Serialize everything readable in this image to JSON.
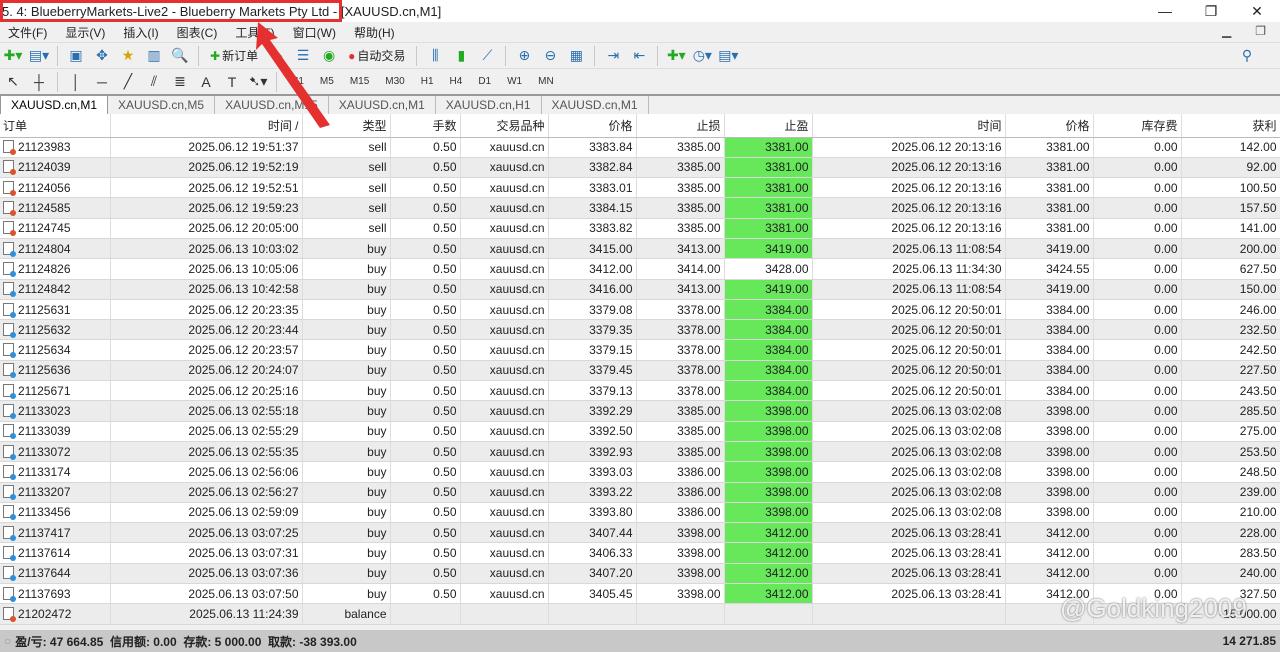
{
  "window": {
    "title": "5.   4: BlueberryMarkets-Live2 - Blueberry Markets Pty Ltd - [XAUUSD.cn,M1]",
    "minimize": "—",
    "restore": "❐",
    "close": "✕"
  },
  "menu": [
    "文件(F)",
    "显示(V)",
    "插入(I)",
    "图表(C)",
    "工具(T)",
    "窗口(W)",
    "帮助(H)"
  ],
  "toolbar": {
    "new_order": "新订单",
    "auto_trade": "自动交易"
  },
  "timeframes": [
    "M1",
    "M5",
    "M15",
    "M30",
    "H1",
    "H4",
    "D1",
    "W1",
    "MN"
  ],
  "chart_tabs": [
    "XAUUSD.cn,M1",
    "XAUUSD.cn,M5",
    "XAUUSD.cn,M15",
    "XAUUSD.cn,M1",
    "XAUUSD.cn,H1",
    "XAUUSD.cn,M1"
  ],
  "columns": [
    "订单",
    "时间 /",
    "类型",
    "手数",
    "交易品种",
    "价格",
    "止损",
    "止盈",
    "时间",
    "价格",
    "库存费",
    "获利"
  ],
  "colors": {
    "tp_hit": "#66e85a",
    "sell_icon": "#d9532c",
    "buy_icon": "#2f8fd8"
  },
  "rows": [
    [
      "21123983",
      "2025.06.12 19:51:37",
      "sell",
      "0.50",
      "xauusd.cn",
      "3383.84",
      "3385.00",
      "3381.00",
      "2025.06.12 20:13:16",
      "3381.00",
      "0.00",
      "142.00",
      true
    ],
    [
      "21124039",
      "2025.06.12 19:52:19",
      "sell",
      "0.50",
      "xauusd.cn",
      "3382.84",
      "3385.00",
      "3381.00",
      "2025.06.12 20:13:16",
      "3381.00",
      "0.00",
      "92.00",
      true
    ],
    [
      "21124056",
      "2025.06.12 19:52:51",
      "sell",
      "0.50",
      "xauusd.cn",
      "3383.01",
      "3385.00",
      "3381.00",
      "2025.06.12 20:13:16",
      "3381.00",
      "0.00",
      "100.50",
      true
    ],
    [
      "21124585",
      "2025.06.12 19:59:23",
      "sell",
      "0.50",
      "xauusd.cn",
      "3384.15",
      "3385.00",
      "3381.00",
      "2025.06.12 20:13:16",
      "3381.00",
      "0.00",
      "157.50",
      true
    ],
    [
      "21124745",
      "2025.06.12 20:05:00",
      "sell",
      "0.50",
      "xauusd.cn",
      "3383.82",
      "3385.00",
      "3381.00",
      "2025.06.12 20:13:16",
      "3381.00",
      "0.00",
      "141.00",
      true
    ],
    [
      "21124804",
      "2025.06.13 10:03:02",
      "buy",
      "0.50",
      "xauusd.cn",
      "3415.00",
      "3413.00",
      "3419.00",
      "2025.06.13 11:08:54",
      "3419.00",
      "0.00",
      "200.00",
      true
    ],
    [
      "21124826",
      "2025.06.13 10:05:06",
      "buy",
      "0.50",
      "xauusd.cn",
      "3412.00",
      "3414.00",
      "3428.00",
      "2025.06.13 11:34:30",
      "3424.55",
      "0.00",
      "627.50",
      false
    ],
    [
      "21124842",
      "2025.06.13 10:42:58",
      "buy",
      "0.50",
      "xauusd.cn",
      "3416.00",
      "3413.00",
      "3419.00",
      "2025.06.13 11:08:54",
      "3419.00",
      "0.00",
      "150.00",
      true
    ],
    [
      "21125631",
      "2025.06.12 20:23:35",
      "buy",
      "0.50",
      "xauusd.cn",
      "3379.08",
      "3378.00",
      "3384.00",
      "2025.06.12 20:50:01",
      "3384.00",
      "0.00",
      "246.00",
      true
    ],
    [
      "21125632",
      "2025.06.12 20:23:44",
      "buy",
      "0.50",
      "xauusd.cn",
      "3379.35",
      "3378.00",
      "3384.00",
      "2025.06.12 20:50:01",
      "3384.00",
      "0.00",
      "232.50",
      true
    ],
    [
      "21125634",
      "2025.06.12 20:23:57",
      "buy",
      "0.50",
      "xauusd.cn",
      "3379.15",
      "3378.00",
      "3384.00",
      "2025.06.12 20:50:01",
      "3384.00",
      "0.00",
      "242.50",
      true
    ],
    [
      "21125636",
      "2025.06.12 20:24:07",
      "buy",
      "0.50",
      "xauusd.cn",
      "3379.45",
      "3378.00",
      "3384.00",
      "2025.06.12 20:50:01",
      "3384.00",
      "0.00",
      "227.50",
      true
    ],
    [
      "21125671",
      "2025.06.12 20:25:16",
      "buy",
      "0.50",
      "xauusd.cn",
      "3379.13",
      "3378.00",
      "3384.00",
      "2025.06.12 20:50:01",
      "3384.00",
      "0.00",
      "243.50",
      true
    ],
    [
      "21133023",
      "2025.06.13 02:55:18",
      "buy",
      "0.50",
      "xauusd.cn",
      "3392.29",
      "3385.00",
      "3398.00",
      "2025.06.13 03:02:08",
      "3398.00",
      "0.00",
      "285.50",
      true
    ],
    [
      "21133039",
      "2025.06.13 02:55:29",
      "buy",
      "0.50",
      "xauusd.cn",
      "3392.50",
      "3385.00",
      "3398.00",
      "2025.06.13 03:02:08",
      "3398.00",
      "0.00",
      "275.00",
      true
    ],
    [
      "21133072",
      "2025.06.13 02:55:35",
      "buy",
      "0.50",
      "xauusd.cn",
      "3392.93",
      "3385.00",
      "3398.00",
      "2025.06.13 03:02:08",
      "3398.00",
      "0.00",
      "253.50",
      true
    ],
    [
      "21133174",
      "2025.06.13 02:56:06",
      "buy",
      "0.50",
      "xauusd.cn",
      "3393.03",
      "3386.00",
      "3398.00",
      "2025.06.13 03:02:08",
      "3398.00",
      "0.00",
      "248.50",
      true
    ],
    [
      "21133207",
      "2025.06.13 02:56:27",
      "buy",
      "0.50",
      "xauusd.cn",
      "3393.22",
      "3386.00",
      "3398.00",
      "2025.06.13 03:02:08",
      "3398.00",
      "0.00",
      "239.00",
      true
    ],
    [
      "21133456",
      "2025.06.13 02:59:09",
      "buy",
      "0.50",
      "xauusd.cn",
      "3393.80",
      "3386.00",
      "3398.00",
      "2025.06.13 03:02:08",
      "3398.00",
      "0.00",
      "210.00",
      true
    ],
    [
      "21137417",
      "2025.06.13 03:07:25",
      "buy",
      "0.50",
      "xauusd.cn",
      "3407.44",
      "3398.00",
      "3412.00",
      "2025.06.13 03:28:41",
      "3412.00",
      "0.00",
      "228.00",
      true
    ],
    [
      "21137614",
      "2025.06.13 03:07:31",
      "buy",
      "0.50",
      "xauusd.cn",
      "3406.33",
      "3398.00",
      "3412.00",
      "2025.06.13 03:28:41",
      "3412.00",
      "0.00",
      "283.50",
      true
    ],
    [
      "21137644",
      "2025.06.13 03:07:36",
      "buy",
      "0.50",
      "xauusd.cn",
      "3407.20",
      "3398.00",
      "3412.00",
      "2025.06.13 03:28:41",
      "3412.00",
      "0.00",
      "240.00",
      true
    ],
    [
      "21137693",
      "2025.06.13 03:07:50",
      "buy",
      "0.50",
      "xauusd.cn",
      "3405.45",
      "3398.00",
      "3412.00",
      "2025.06.13 03:28:41",
      "3412.00",
      "0.00",
      "327.50",
      true
    ]
  ],
  "balance_row": {
    "order": "21202472",
    "time": "2025.06.13 11:24:39",
    "type": "balance",
    "profit": "-15 000.00"
  },
  "status": {
    "summary": "盈/亏: 47 664.85  信用额: 0.00  存款: 5 000.00  取款: -38 393.00",
    "total": "14 271.85"
  },
  "watermark": "@Goldking2009"
}
